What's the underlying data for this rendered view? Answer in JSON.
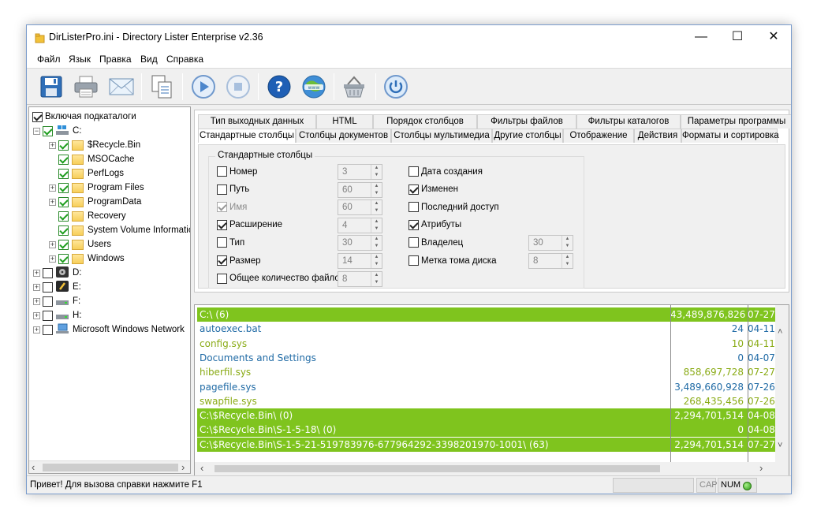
{
  "window": {
    "title": "DirListerPro.ini - Directory Lister Enterprise v2.36"
  },
  "menu": [
    "Файл",
    "Язык",
    "Правка",
    "Вид",
    "Справка"
  ],
  "toolbar_icons": [
    "save-icon",
    "print-icon",
    "email-icon",
    "copy-icon",
    "play-icon",
    "stop-icon",
    "help-icon",
    "web-icon",
    "basket-icon",
    "power-icon"
  ],
  "tree": {
    "include_subdirs_label": "Включая подкаталоги",
    "nodes": [
      {
        "label": "C:",
        "level": 0,
        "checked": true,
        "kind": "drive-win",
        "expanded": true
      },
      {
        "label": "$Recycle.Bin",
        "level": 1,
        "checked": true,
        "kind": "folder",
        "expander": true
      },
      {
        "label": "MSOCache",
        "level": 1,
        "checked": true,
        "kind": "folder",
        "expander": false
      },
      {
        "label": "PerfLogs",
        "level": 1,
        "checked": true,
        "kind": "folder",
        "expander": false
      },
      {
        "label": "Program Files",
        "level": 1,
        "checked": true,
        "kind": "folder",
        "expander": true
      },
      {
        "label": "ProgramData",
        "level": 1,
        "checked": true,
        "kind": "folder",
        "expander": true
      },
      {
        "label": "Recovery",
        "level": 1,
        "checked": true,
        "kind": "folder",
        "expander": false
      },
      {
        "label": "System Volume Informatic",
        "level": 1,
        "checked": true,
        "kind": "folder",
        "expander": false
      },
      {
        "label": "Users",
        "level": 1,
        "checked": true,
        "kind": "folder",
        "expander": true
      },
      {
        "label": "Windows",
        "level": 1,
        "checked": true,
        "kind": "folder",
        "expander": true
      },
      {
        "label": "D:",
        "level": 0,
        "checked": false,
        "kind": "drive-cd",
        "expander": true
      },
      {
        "label": "E:",
        "level": 0,
        "checked": false,
        "kind": "drive-usb",
        "expander": true
      },
      {
        "label": "F:",
        "level": 0,
        "checked": false,
        "kind": "drive-hdd",
        "expander": true
      },
      {
        "label": "H:",
        "level": 0,
        "checked": false,
        "kind": "drive-hdd",
        "expander": true
      },
      {
        "label": "Microsoft Windows Network",
        "level": 0,
        "checked": false,
        "kind": "network",
        "expander": true
      }
    ]
  },
  "tabs": {
    "row1": [
      "Тип выходных данных",
      "HTML",
      "Порядок столбцов",
      "Фильтры файлов",
      "Фильтры каталогов",
      "Параметры программы"
    ],
    "row2": [
      "Стандартные столбцы",
      "Столбцы документов",
      "Столбцы мультимедиа",
      "Другие столбцы",
      "Отображение",
      "Действия",
      "Форматы и сортировка"
    ],
    "active": "Стандартные столбцы"
  },
  "standard_columns": {
    "group_title": "Стандартные столбцы",
    "left": [
      {
        "label": "Номер",
        "checked": false,
        "disabled": false,
        "value": "3"
      },
      {
        "label": "Путь",
        "checked": false,
        "disabled": false,
        "value": "60"
      },
      {
        "label": "Имя",
        "checked": true,
        "disabled": true,
        "value": "60"
      },
      {
        "label": "Расширение",
        "checked": true,
        "disabled": false,
        "value": "4"
      },
      {
        "label": "Тип",
        "checked": false,
        "disabled": false,
        "value": "30"
      },
      {
        "label": "Размер",
        "checked": true,
        "disabled": false,
        "value": "14"
      },
      {
        "label": "Общее количество файлов",
        "checked": false,
        "disabled": false,
        "value": "8"
      }
    ],
    "right": [
      {
        "label": "Дата создания",
        "checked": false,
        "value": null
      },
      {
        "label": "Изменен",
        "checked": true,
        "value": null
      },
      {
        "label": "Последний доступ",
        "checked": false,
        "value": null
      },
      {
        "label": "Атрибуты",
        "checked": true,
        "value": null
      },
      {
        "label": "Владелец",
        "checked": false,
        "value": "30"
      },
      {
        "label": "Метка тома диска",
        "checked": false,
        "value": "8"
      }
    ]
  },
  "results": {
    "rows": [
      {
        "kind": "group",
        "name": "C:\\ (6)",
        "size": "43,489,876,826",
        "date": "07-27"
      },
      {
        "kind": "file",
        "name": "autoexec.bat",
        "size": "24",
        "date": "04-11"
      },
      {
        "kind": "file-alt",
        "name": "config.sys",
        "size": "10",
        "date": "04-11"
      },
      {
        "kind": "file",
        "name": "Documents and Settings",
        "size": "0",
        "date": "04-07"
      },
      {
        "kind": "file-alt",
        "name": "hiberfil.sys",
        "size": "858,697,728",
        "date": "07-27"
      },
      {
        "kind": "file",
        "name": "pagefile.sys",
        "size": "3,489,660,928",
        "date": "07-26"
      },
      {
        "kind": "file-alt",
        "name": "swapfile.sys",
        "size": "268,435,456",
        "date": "07-26"
      },
      {
        "kind": "group",
        "name": "C:\\$Recycle.Bin\\ (0)",
        "size": "2,294,701,514",
        "date": "04-08"
      },
      {
        "kind": "group",
        "name": "C:\\$Recycle.Bin\\S-1-5-18\\ (0)",
        "size": "0",
        "date": "04-08"
      },
      {
        "kind": "group",
        "name": "C:\\$Recycle.Bin\\S-1-5-21-519783976-677964292-3398201970-1001\\ (63)",
        "size": "2,294,701,514",
        "date": "07-27"
      }
    ]
  },
  "status": {
    "text": "Привет! Для вызова справки нажмите F1",
    "cap": "CAP",
    "num": "NUM"
  }
}
